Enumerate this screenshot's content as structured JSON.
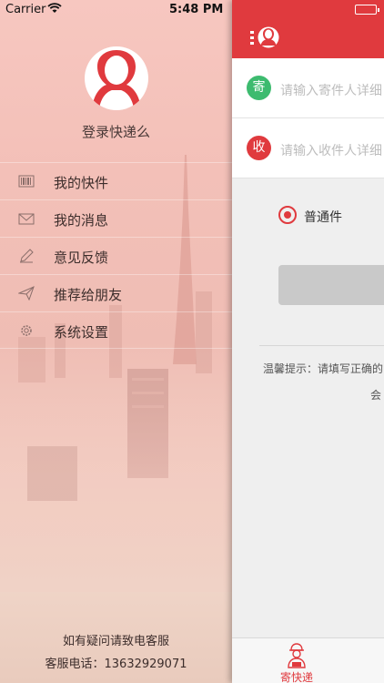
{
  "status_bar": {
    "carrier": "Carrier",
    "time": "5:48 PM",
    "wifi_icon": "wifi-icon",
    "battery_icon": "battery-icon"
  },
  "drawer": {
    "login_text": "登录快递么",
    "menu": [
      {
        "label": "我的快件",
        "icon": "barcode-icon"
      },
      {
        "label": "我的消息",
        "icon": "envelope-icon"
      },
      {
        "label": "意见反馈",
        "icon": "pencil-icon"
      },
      {
        "label": "推荐给朋友",
        "icon": "paper-plane-icon"
      },
      {
        "label": "系统设置",
        "icon": "gear-icon"
      }
    ],
    "footer_line1": "如有疑问请致电客服",
    "footer_line2": "客服电话：13632929071"
  },
  "main": {
    "navbar_icon": "user-icon",
    "sender": {
      "badge": "寄",
      "placeholder": "请输入寄件人详细"
    },
    "receiver": {
      "badge": "收",
      "placeholder": "请输入收件人详细"
    },
    "delivery_option": "普通件",
    "tip_line1": "温馨提示：请填写正确的",
    "tip_line2": "会",
    "tab_send_label": "寄快递"
  },
  "colors": {
    "accent_red": "#e03a3e",
    "sender_green": "#3dbb6f",
    "button_gray": "#c9c9c9"
  }
}
